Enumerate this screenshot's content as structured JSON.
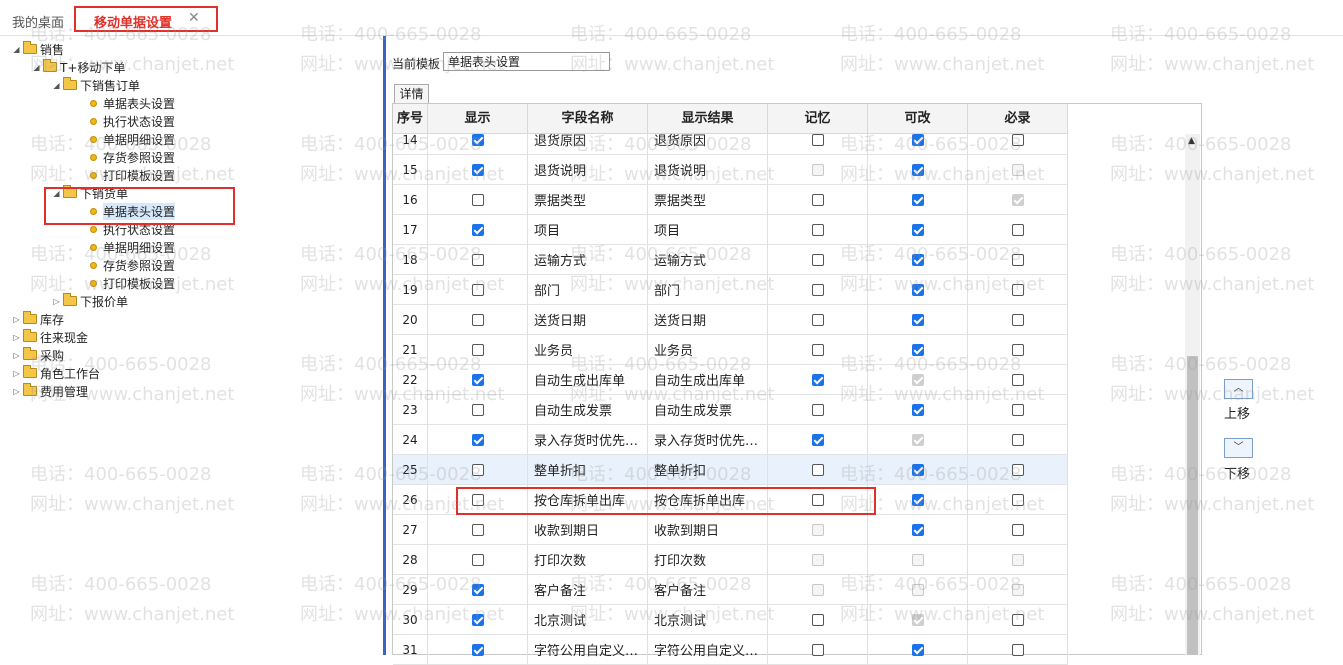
{
  "tabs": {
    "desktop": "我的桌面",
    "active": "移动单据设置",
    "close_glyph": "✕"
  },
  "tree": {
    "sales": "销售",
    "tplus_mobile": "T+移动下单",
    "sales_order": "下销售订单",
    "order_items": [
      "单据表头设置",
      "执行状态设置",
      "单据明细设置",
      "存货参照设置",
      "打印模板设置"
    ],
    "sales_delivery": "下销货单",
    "delivery_items": [
      "单据表头设置",
      "执行状态设置",
      "单据明细设置",
      "存货参照设置",
      "打印模板设置"
    ],
    "quotation": "下报价单",
    "others": [
      "库存",
      "往来现金",
      "采购",
      "角色工作台",
      "费用管理"
    ]
  },
  "template": {
    "label": "当前模板",
    "value": "单据表头设置"
  },
  "detail_tab": "详情",
  "grid": {
    "headers": [
      "序号",
      "显示",
      "字段名称",
      "显示结果",
      "记忆",
      "可改",
      "必录"
    ],
    "rows": [
      {
        "no": "14",
        "show": "on",
        "name": "退货原因",
        "result": "退货原因",
        "mem": "off",
        "edit": "on",
        "req": "off"
      },
      {
        "no": "15",
        "show": "on",
        "name": "退货说明",
        "result": "退货说明",
        "mem": "dis",
        "edit": "on",
        "req": "dis"
      },
      {
        "no": "16",
        "show": "off",
        "name": "票据类型",
        "result": "票据类型",
        "mem": "off",
        "edit": "on",
        "req": "dison"
      },
      {
        "no": "17",
        "show": "on",
        "name": "项目",
        "result": "项目",
        "mem": "off",
        "edit": "on",
        "req": "off"
      },
      {
        "no": "18",
        "show": "off",
        "name": "运输方式",
        "result": "运输方式",
        "mem": "off",
        "edit": "on",
        "req": "off"
      },
      {
        "no": "19",
        "show": "off",
        "name": "部门",
        "result": "部门",
        "mem": "off",
        "edit": "on",
        "req": "off"
      },
      {
        "no": "20",
        "show": "off",
        "name": "送货日期",
        "result": "送货日期",
        "mem": "off",
        "edit": "on",
        "req": "off"
      },
      {
        "no": "21",
        "show": "off",
        "name": "业务员",
        "result": "业务员",
        "mem": "off",
        "edit": "on",
        "req": "off"
      },
      {
        "no": "22",
        "show": "on",
        "name": "自动生成出库单",
        "result": "自动生成出库单",
        "mem": "on",
        "edit": "dison",
        "req": "off"
      },
      {
        "no": "23",
        "show": "off",
        "name": "自动生成发票",
        "result": "自动生成发票",
        "mem": "off",
        "edit": "on",
        "req": "off"
      },
      {
        "no": "24",
        "show": "on",
        "name": "录入存货时优先…",
        "result": "录入存货时优先…",
        "mem": "on",
        "edit": "dison",
        "req": "off"
      },
      {
        "no": "25",
        "show": "off",
        "name": "整单折扣",
        "result": "整单折扣",
        "mem": "off",
        "edit": "on",
        "req": "off",
        "hl": true
      },
      {
        "no": "26",
        "show": "off",
        "name": "按仓库拆单出库",
        "result": "按仓库拆单出库",
        "mem": "off",
        "edit": "on",
        "req": "off"
      },
      {
        "no": "27",
        "show": "off",
        "name": "收款到期日",
        "result": "收款到期日",
        "mem": "dis",
        "edit": "on",
        "req": "off"
      },
      {
        "no": "28",
        "show": "off",
        "name": "打印次数",
        "result": "打印次数",
        "mem": "dis",
        "edit": "dis",
        "req": "dis"
      },
      {
        "no": "29",
        "show": "on",
        "name": "客户备注",
        "result": "客户备注",
        "mem": "dis",
        "edit": "dis",
        "req": "dis"
      },
      {
        "no": "30",
        "show": "on",
        "name": "北京测试",
        "result": "北京测试",
        "mem": "off",
        "edit": "dison",
        "req": "off"
      },
      {
        "no": "31",
        "show": "on",
        "name": "字符公用自定义…",
        "result": "字符公用自定义…",
        "mem": "off",
        "edit": "on",
        "req": "off"
      }
    ]
  },
  "buttons": {
    "move_up": "上移",
    "move_down": "下移",
    "up_glyph": "︿",
    "down_glyph": "﹀"
  },
  "watermark": {
    "phone": "电话：400-665-0028",
    "site": "网址：www.chanjet.net"
  },
  "colors": {
    "accent_red": "#e1302a",
    "checkbox_blue": "#1a73e8",
    "splitter_blue": "#3864c6"
  }
}
